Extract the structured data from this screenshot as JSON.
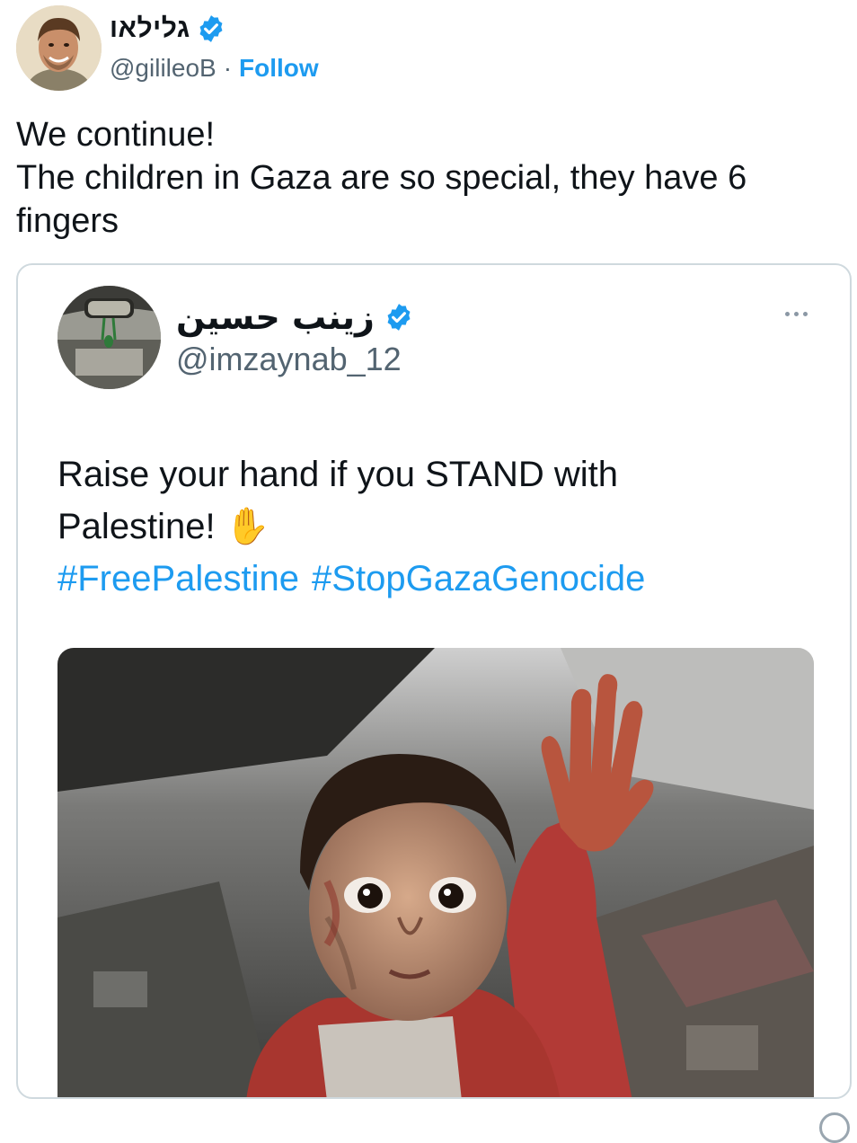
{
  "outer_tweet": {
    "display_name": "גלילאו",
    "handle": "@gilileoB",
    "separator": "·",
    "follow_label": "Follow",
    "text_lines": [
      "We continue!",
      "The children in Gaza are so special, they have 6",
      "fingers"
    ]
  },
  "quoted_tweet": {
    "display_name": "زينب حسين",
    "handle": "@imzaynab_12",
    "text_lines": [
      "Raise your hand if you STAND with",
      "Palestine!"
    ],
    "emoji": "✋",
    "hashtags": [
      "#FreePalestine",
      "#StopGazaGenocide"
    ]
  },
  "colors": {
    "link_blue": "#1d9bf0",
    "secondary_text": "#536471",
    "card_border": "#cfd9de"
  },
  "icons": {
    "verified": "verified-badge-icon",
    "more": "more-dots-icon"
  }
}
